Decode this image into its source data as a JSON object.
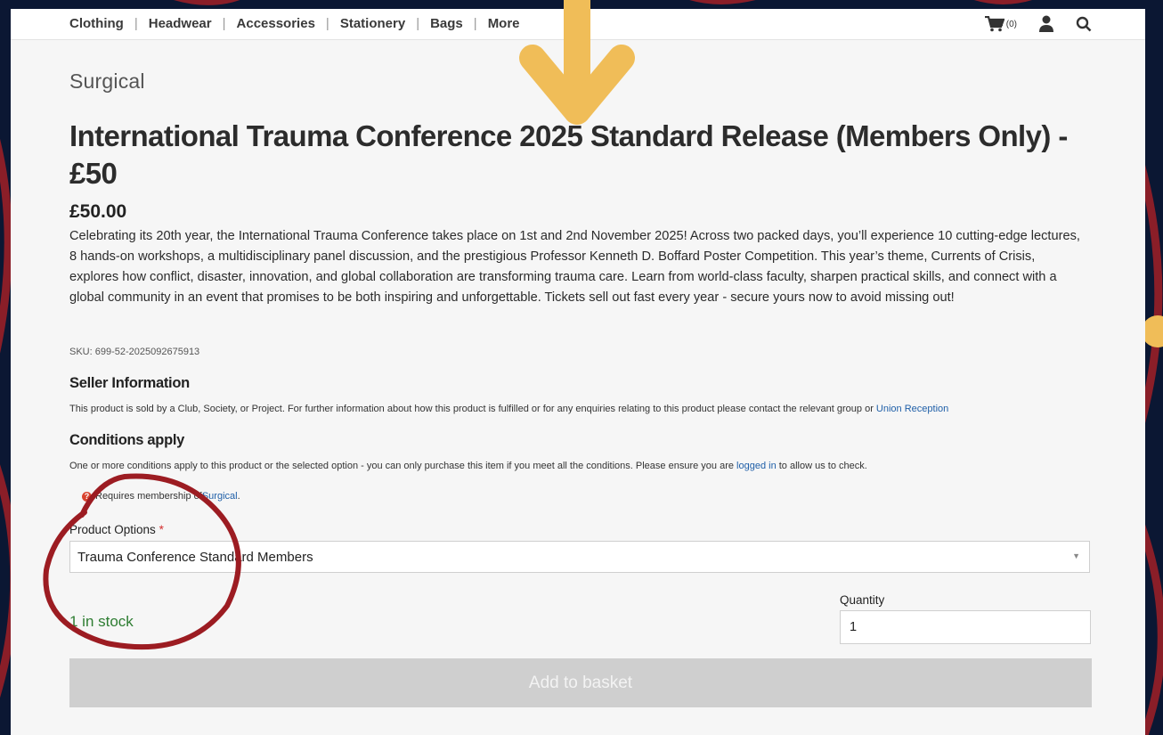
{
  "nav": {
    "items": [
      {
        "label": "Clothing"
      },
      {
        "label": "Headwear"
      },
      {
        "label": "Accessories"
      },
      {
        "label": "Stationery"
      },
      {
        "label": "Bags"
      },
      {
        "label": "More"
      }
    ],
    "separator": "|",
    "cart_count": "(0)"
  },
  "product": {
    "category": "Surgical",
    "title": "International Trauma Conference 2025 Standard Release (Members Only) - £50",
    "price": "£50.00",
    "description": "Celebrating its 20th year, the International Trauma Conference takes place on 1st and 2nd November 2025! Across two packed days, you’ll experience 10 cutting-edge lectures, 8 hands-on workshops, a multidisciplinary panel discussion, and the prestigious Professor Kenneth D. Boffard Poster Competition. This year’s theme, Currents of Crisis, explores how conflict, disaster, innovation, and global collaboration are transforming trauma care. Learn from world-class faculty, sharpen practical skills, and connect with a global community in an event that promises to be both inspiring and unforgettable. Tickets sell out fast every year - secure yours now to avoid missing out!",
    "sku": "SKU: 699-52-2025092675913"
  },
  "seller": {
    "heading": "Seller Information",
    "text": "This product is sold by a Club, Society, or Project. For further information about how this product is fulfilled or for any enquiries relating to this product please contact the relevant group or ",
    "link": "Union Reception"
  },
  "conditions": {
    "heading": "Conditions apply",
    "text": "One or more conditions apply to this product or the selected option - you can only purchase this item if you meet all the conditions. Please ensure you are ",
    "link": "logged in",
    "text_after": " to allow us to check.",
    "requirement_prefix": "Requires membership of ",
    "requirement_link": "Surgical",
    "requirement_suffix": "."
  },
  "options": {
    "label": "Product Options",
    "required_mark": "*",
    "selected": "Trauma Conference Standard Members",
    "arrow": "▼"
  },
  "stock": "1 in stock",
  "quantity": {
    "label": "Quantity",
    "value": "1"
  },
  "add_button": "Add to basket",
  "colors": {
    "background": "#0b1733",
    "accent_arrow": "#f0bd58",
    "annotation_circle": "#9c1c22",
    "stock_green": "#2e7d32"
  },
  "icons": [
    "cart-icon",
    "user-icon",
    "search-icon",
    "arrow-down-icon",
    "question-icon"
  ]
}
